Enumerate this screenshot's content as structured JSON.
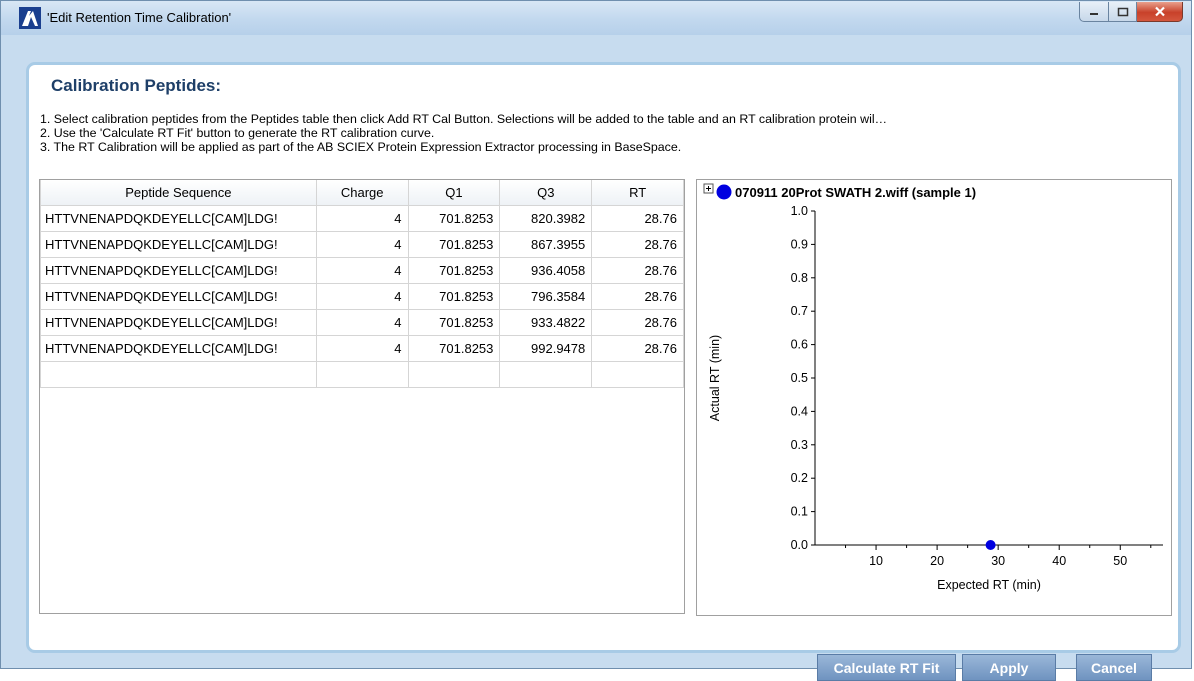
{
  "window": {
    "title": "'Edit Retention Time Calibration'"
  },
  "panel": {
    "title": "Calibration Peptides:"
  },
  "instructions": [
    "1. Select calibration peptides from the Peptides table then click Add RT Cal Button. Selections will be added to the table and an RT calibration protein wil…",
    "2. Use the 'Calculate RT Fit' button to generate the RT calibration curve.",
    "3. The RT Calibration will be applied as part of the AB SCIEX Protein Expression Extractor processing in BaseSpace."
  ],
  "table": {
    "columns": [
      "Peptide Sequence",
      "Charge",
      "Q1",
      "Q3",
      "RT"
    ],
    "rows": [
      [
        "HTTVNENAPDQKDEYELLC[CAM]LDG!",
        "4",
        "701.8253",
        "820.3982",
        "28.76"
      ],
      [
        "HTTVNENAPDQKDEYELLC[CAM]LDG!",
        "4",
        "701.8253",
        "867.3955",
        "28.76"
      ],
      [
        "HTTVNENAPDQKDEYELLC[CAM]LDG!",
        "4",
        "701.8253",
        "936.4058",
        "28.76"
      ],
      [
        "HTTVNENAPDQKDEYELLC[CAM]LDG!",
        "4",
        "701.8253",
        "796.3584",
        "28.76"
      ],
      [
        "HTTVNENAPDQKDEYELLC[CAM]LDG!",
        "4",
        "701.8253",
        "933.4822",
        "28.76"
      ],
      [
        "HTTVNENAPDQKDEYELLC[CAM]LDG!",
        "4",
        "701.8253",
        "992.9478",
        "28.76"
      ],
      [
        "",
        "",
        "",
        "",
        ""
      ]
    ]
  },
  "chart_data": {
    "type": "scatter",
    "legend": "070911 20Prot SWATH 2.wiff (sample 1)",
    "legend_color": "#0000e0",
    "xlabel": "Expected RT (min)",
    "ylabel": "Actual RT (min)",
    "xlim": [
      0,
      57
    ],
    "ylim": [
      0,
      1.0
    ],
    "xticks": [
      "10",
      "20",
      "30",
      "40",
      "50"
    ],
    "xtick_values": [
      10,
      20,
      30,
      40,
      50
    ],
    "yticks": [
      "0.0",
      "0.1",
      "0.2",
      "0.3",
      "0.4",
      "0.5",
      "0.6",
      "0.7",
      "0.8",
      "0.9",
      "1.0"
    ],
    "ytick_values": [
      0,
      0.1,
      0.2,
      0.3,
      0.4,
      0.5,
      0.6,
      0.7,
      0.8,
      0.9,
      1.0
    ],
    "points": [
      {
        "x": 28.76,
        "y": 0
      }
    ],
    "grid": false
  },
  "buttons": {
    "calculate": "Calculate RT Fit",
    "apply": "Apply",
    "cancel": "Cancel"
  },
  "colors": {
    "accent": "#6f93c0",
    "title_text": "#1e3f68"
  }
}
